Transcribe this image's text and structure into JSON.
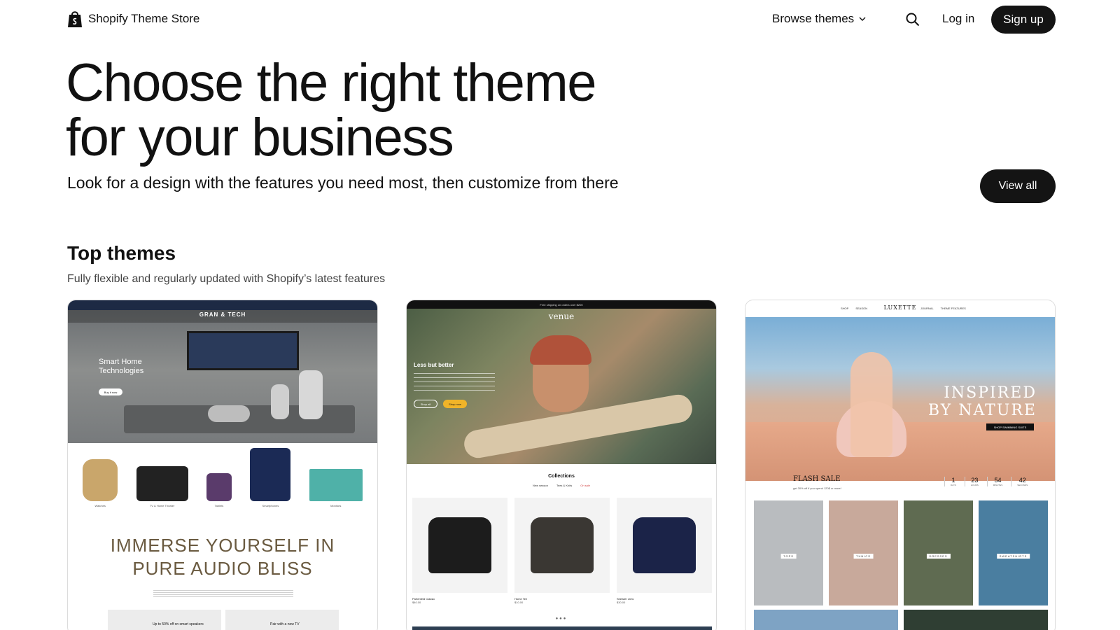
{
  "header": {
    "logo_text": "Shopify Theme Store",
    "logo_icon": "shopify-bag-icon",
    "browse_label": "Browse themes",
    "search_icon": "search-icon",
    "login_label": "Log in",
    "signup_label": "Sign up"
  },
  "hero": {
    "title_line1": "Choose the right theme",
    "title_line2": "for your business",
    "subtitle": "Look for a design with the features you need most, then customize from there",
    "view_all_label": "View all"
  },
  "top_themes": {
    "title": "Top themes",
    "subtitle": "Fully flexible and regularly updated with Shopify’s latest features"
  },
  "cards": [
    {
      "brand": "GRAN & TECH",
      "hero_title_line1": "Smart Home",
      "hero_title_line2": "Technologies",
      "hero_button": "Buy it now",
      "products": [
        {
          "label": "Watches"
        },
        {
          "label": "TV & Home Theater"
        },
        {
          "label": "Tablets"
        },
        {
          "label": "Smartphones"
        },
        {
          "label": "Monitors"
        }
      ],
      "immerse_line1": "IMMERSE YOURSELF IN",
      "immerse_line2": "PURE AUDIO BLISS",
      "banner1": "Up to 50% off on smart speakers",
      "banner2": "Pair with a new TV"
    },
    {
      "brand": "venue",
      "topbar": "Free shipping on orders over $200",
      "hero_title": "Less but better",
      "btn1": "Shop all",
      "btn2": "Shop now",
      "collections_title": "Collections",
      "tabs": [
        "New season",
        "Tees & Knits",
        "On sale"
      ],
      "items": [
        {
          "name": "Partenfeld Classic",
          "price": "$40.00"
        },
        {
          "name": "Home Tee",
          "price": "$10.00"
        },
        {
          "name": "Sheister crew",
          "price": "$30.00"
        }
      ],
      "dots": "●●●"
    },
    {
      "brand": "LUXETTE",
      "nav_links": [
        "SHOP",
        "SEASON",
        "JOURNAL",
        "THEME FEATURES"
      ],
      "hero_line1": "INSPIRED",
      "hero_line2": "BY NATURE",
      "hero_button": "SHOP SWIMMING SUITS",
      "flash_title": "FLASH SALE",
      "flash_sub": "get 30% off if you spend 120$ or more!",
      "timer": [
        {
          "num": "1",
          "label": "DAYS"
        },
        {
          "num": "23",
          "label": "HOURS"
        },
        {
          "num": "54",
          "label": "MINUTES"
        },
        {
          "num": "42",
          "label": "SECONDS"
        }
      ],
      "categories": [
        "TOPS",
        "TUNICS",
        "DRESSES",
        "SWEATSHIRTS"
      ]
    }
  ],
  "colors": {
    "button_dark": "#141414",
    "text_primary": "#111111",
    "text_secondary": "#444444"
  }
}
